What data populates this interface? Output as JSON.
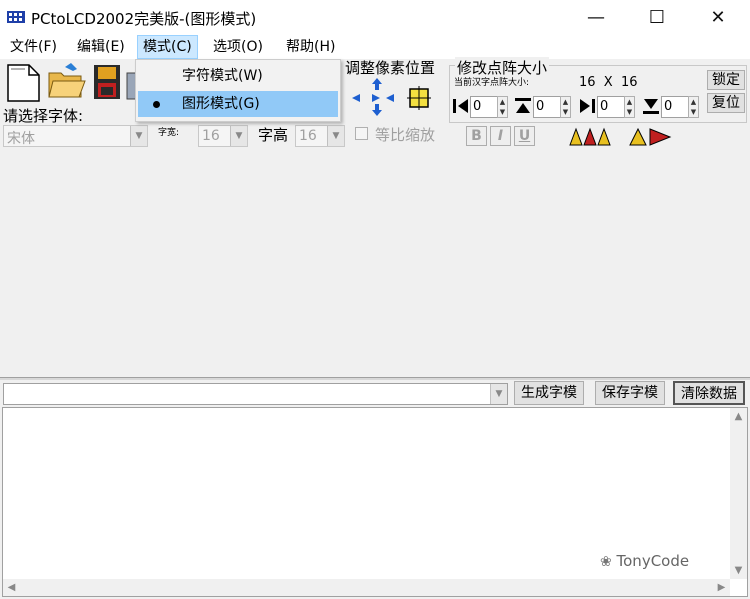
{
  "window": {
    "title": "PCtoLCD2002完美版-(图形模式)",
    "controls": {
      "minimize": "—",
      "maximize": "☐",
      "close": "✕"
    }
  },
  "menu": {
    "file": "文件(F)",
    "edit": "编辑(E)",
    "mode": "模式(C)",
    "options": "选项(O)",
    "help": "帮助(H)"
  },
  "mode_menu": {
    "char_mode": "字符模式(W)",
    "graphic_mode": "图形模式(G)",
    "selected": "graphic_mode"
  },
  "font": {
    "select_label": "请选择字体:",
    "font_value": "宋体",
    "width_label": "字宽:",
    "width_value": "16",
    "height_label": "字高",
    "height_value": "16",
    "scale_label": "等比缩放",
    "bold": "B",
    "italic": "I",
    "underline": "U"
  },
  "pixel_adjust": {
    "label": "调整像素位置"
  },
  "matrix": {
    "label": "修改点阵大小",
    "current_label": "当前汉字点阵大小:",
    "size_text": "16  X  16",
    "lock_button": "锁定",
    "reset_button": "复位",
    "spins": [
      "0",
      "0",
      "0",
      "0"
    ]
  },
  "actions": {
    "generate": "生成字模",
    "save": "保存字模",
    "clear": "清除数据"
  },
  "watermark": "TonyCode",
  "colors": {
    "menu_highlight": "#91c9f7",
    "menu_active": "#cce8ff"
  }
}
